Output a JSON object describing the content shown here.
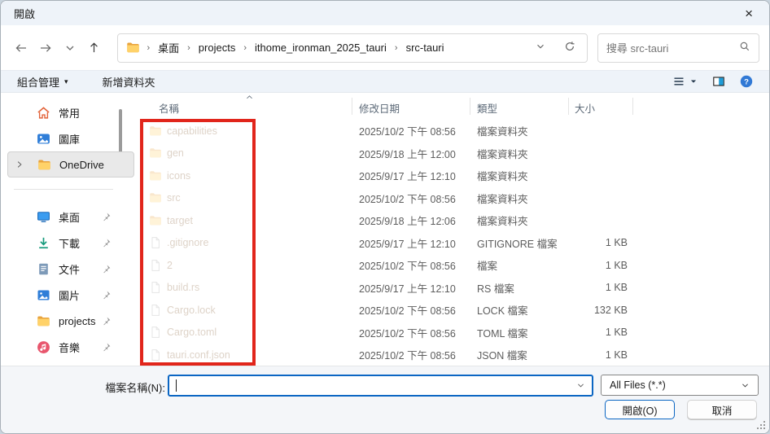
{
  "window": {
    "title": "開啟",
    "close_glyph": "×"
  },
  "nav": {
    "breadcrumb": {
      "root_icon": "folder-icon",
      "separator": "›",
      "crumbs": [
        "桌面",
        "projects",
        "ithome_ironman_2025_tauri",
        "src-tauri"
      ]
    },
    "search": {
      "placeholder": "搜尋 src-tauri",
      "icon": "search-icon"
    }
  },
  "toolbar": {
    "organize_label": "組合管理",
    "organize_caret": "▾",
    "new_folder_label": "新增資料夾"
  },
  "sidebar": {
    "items": [
      {
        "label": "常用",
        "icon": "home-icon"
      },
      {
        "label": "圖庫",
        "icon": "gallery-icon"
      },
      {
        "label": "OneDrive",
        "icon": "folder-icon",
        "selected": true,
        "expandable": true
      },
      {
        "divider": true
      },
      {
        "label": "桌面",
        "icon": "desktop-icon",
        "pinned": true
      },
      {
        "label": "下載",
        "icon": "download-icon",
        "pinned": true
      },
      {
        "label": "文件",
        "icon": "document-icon",
        "pinned": true
      },
      {
        "label": "圖片",
        "icon": "pictures-icon",
        "pinned": true
      },
      {
        "label": "projects",
        "icon": "folder-icon",
        "pinned": true
      },
      {
        "label": "音樂",
        "icon": "music-icon",
        "pinned": true
      }
    ]
  },
  "file_list": {
    "columns": {
      "name": "名稱",
      "date": "修改日期",
      "type": "類型",
      "size": "大小"
    },
    "sorted_column": "name",
    "rows": [
      {
        "name": "capabilities",
        "icon": "folder-icon",
        "date": "2025/10/2 下午 08:56",
        "type": "檔案資料夾",
        "size": ""
      },
      {
        "name": "gen",
        "icon": "folder-icon",
        "date": "2025/9/18 上午 12:00",
        "type": "檔案資料夾",
        "size": ""
      },
      {
        "name": "icons",
        "icon": "folder-icon",
        "date": "2025/9/17 上午 12:10",
        "type": "檔案資料夾",
        "size": ""
      },
      {
        "name": "src",
        "icon": "folder-icon",
        "date": "2025/10/2 下午 08:56",
        "type": "檔案資料夾",
        "size": ""
      },
      {
        "name": "target",
        "icon": "folder-icon",
        "date": "2025/9/18 上午 12:06",
        "type": "檔案資料夾",
        "size": ""
      },
      {
        "name": ".gitignore",
        "icon": "file-icon",
        "date": "2025/9/17 上午 12:10",
        "type": "GITIGNORE 檔案",
        "size": "1 KB"
      },
      {
        "name": "2",
        "icon": "file-icon",
        "date": "2025/10/2 下午 08:56",
        "type": "檔案",
        "size": "1 KB"
      },
      {
        "name": "build.rs",
        "icon": "file-icon",
        "date": "2025/9/17 上午 12:10",
        "type": "RS 檔案",
        "size": "1 KB"
      },
      {
        "name": "Cargo.lock",
        "icon": "file-icon",
        "date": "2025/10/2 下午 08:56",
        "type": "LOCK 檔案",
        "size": "132 KB"
      },
      {
        "name": "Cargo.toml",
        "icon": "file-icon",
        "date": "2025/10/2 下午 08:56",
        "type": "TOML 檔案",
        "size": "1 KB"
      },
      {
        "name": "tauri.conf.json",
        "icon": "file-icon",
        "date": "2025/10/2 下午 08:56",
        "type": "JSON 檔案",
        "size": "1 KB"
      }
    ],
    "annotation": {
      "shape": "rectangle",
      "color": "#e1251b",
      "purpose": "highlights name column"
    }
  },
  "footer": {
    "filename_label": "檔案名稱(N):",
    "filename_value": "",
    "filetype_value": "All Files (*.*)",
    "open_button": "開啟(O)",
    "cancel_button": "取消"
  },
  "colors": {
    "accent": "#0b66c3",
    "chrome_tint": "#eef3f9",
    "annotation_red": "#e1251b",
    "help_blue": "#3179d5"
  }
}
